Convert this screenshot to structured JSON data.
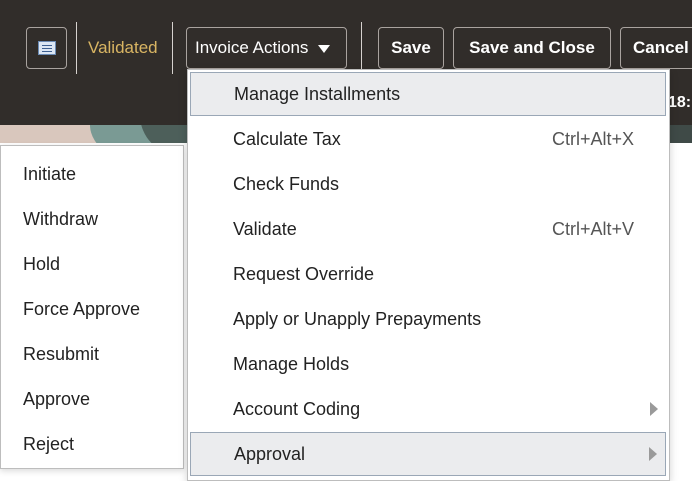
{
  "toolbar": {
    "status": "Validated",
    "actions_label": "Invoice Actions",
    "save_label": "Save",
    "save_close_label": "Save and Close",
    "cancel_label": "Cancel",
    "clock_fragment": "18:"
  },
  "approval_submenu": {
    "items": [
      "Initiate",
      "Withdraw",
      "Hold",
      "Force Approve",
      "Resubmit",
      "Approve",
      "Reject"
    ]
  },
  "actions_menu": {
    "items": [
      {
        "label": "Manage Installments",
        "shortcut": "",
        "submenu": false,
        "highlighted": true
      },
      {
        "label": "Calculate Tax",
        "shortcut": "Ctrl+Alt+X",
        "submenu": false,
        "highlighted": false
      },
      {
        "label": "Check Funds",
        "shortcut": "",
        "submenu": false,
        "highlighted": false
      },
      {
        "label": "Validate",
        "shortcut": "Ctrl+Alt+V",
        "submenu": false,
        "highlighted": false
      },
      {
        "label": "Request Override",
        "shortcut": "",
        "submenu": false,
        "highlighted": false
      },
      {
        "label": "Apply or Unapply Prepayments",
        "shortcut": "",
        "submenu": false,
        "highlighted": false
      },
      {
        "label": "Manage Holds",
        "shortcut": "",
        "submenu": false,
        "highlighted": false
      },
      {
        "label": "Account Coding",
        "shortcut": "",
        "submenu": true,
        "highlighted": false
      },
      {
        "label": "Approval",
        "shortcut": "",
        "submenu": true,
        "highlighted": true
      }
    ]
  },
  "colors": {
    "toolbar_bg": "#312d2a",
    "status_text": "#d9b563",
    "highlight_bg": "#ebecee"
  },
  "icons": {
    "document": "document-icon",
    "caret": "caret-down-icon",
    "submenu_arrow": "chevron-right-icon"
  }
}
